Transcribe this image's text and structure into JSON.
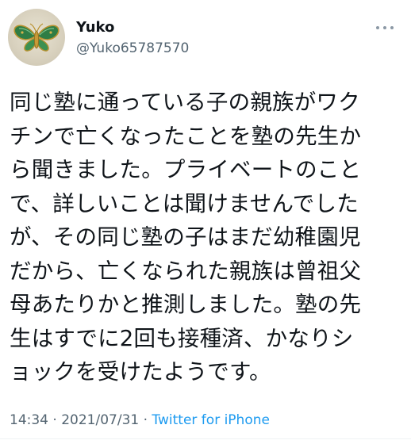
{
  "user": {
    "display_name": "Yuko",
    "handle": "@Yuko65787570",
    "avatar_icon": "butterfly-brooch-icon"
  },
  "tweet": {
    "lines": [
      "同じ塾に通っている子の親族がワク",
      "チンで亡くなったことを塾の先生か",
      "ら聞きました。プライベートのこと",
      "で、詳しいことは聞けませんでした",
      "が、その同じ塾の子はまだ幼稚園児",
      "だから、亡くなられた親族は曾祖父",
      "母あたりかと推測しました。塾の先",
      "生はすでに2回も接種済、かなりシ",
      "ョックを受けたようです。"
    ]
  },
  "meta": {
    "time": "14:34",
    "separator1": " · ",
    "date": "2021/07/31",
    "separator2": " · ",
    "source": "Twitter for iPhone"
  },
  "colors": {
    "text": "#0f1419",
    "secondary": "#536471",
    "link": "#1d9bf0"
  }
}
